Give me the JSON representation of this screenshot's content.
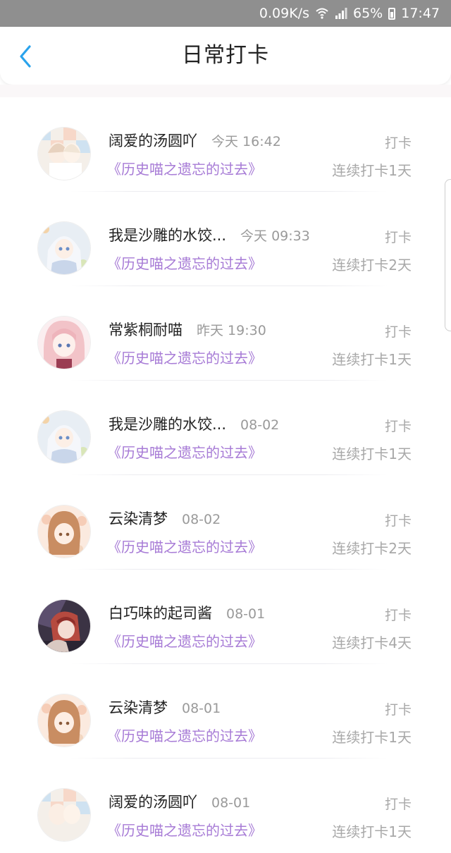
{
  "status_bar": {
    "speed": "0.09K/s",
    "battery": "65%",
    "time": "17:47",
    "icons": [
      "wifi-icon",
      "signal-icon",
      "battery-icon"
    ]
  },
  "header": {
    "title": "日常打卡",
    "back_icon": "chevron-left-icon"
  },
  "colors": {
    "accent": "#2aa3ec",
    "book_title": "#a77bd6",
    "muted": "#a8a8a8"
  },
  "entries": [
    {
      "username": "阔爱的汤圆吖",
      "time": "今天 16:42",
      "book": "《历史喵之遗忘的过去》",
      "action": "打卡",
      "streak": "连续打卡1天",
      "avatar": "avatar-girls-pair"
    },
    {
      "username": "我是沙雕的水饺...",
      "time": "今天 09:33",
      "book": "《历史喵之遗忘的过去》",
      "action": "打卡",
      "streak": "连续打卡2天",
      "avatar": "avatar-white-hair"
    },
    {
      "username": "常紫桐耐喵",
      "time": "昨天 19:30",
      "book": "《历史喵之遗忘的过去》",
      "action": "打卡",
      "streak": "连续打卡1天",
      "avatar": "avatar-pink-hair"
    },
    {
      "username": "我是沙雕的水饺...",
      "time": "08-02",
      "book": "《历史喵之遗忘的过去》",
      "action": "打卡",
      "streak": "连续打卡1天",
      "avatar": "avatar-white-hair"
    },
    {
      "username": "云染清梦",
      "time": "08-02",
      "book": "《历史喵之遗忘的过去》",
      "action": "打卡",
      "streak": "连续打卡2天",
      "avatar": "avatar-brown-hair"
    },
    {
      "username": "白巧味的起司酱",
      "time": "08-01",
      "book": "《历史喵之遗忘的过去》",
      "action": "打卡",
      "streak": "连续打卡4天",
      "avatar": "avatar-red-dark"
    },
    {
      "username": "云染清梦",
      "time": "08-01",
      "book": "《历史喵之遗忘的过去》",
      "action": "打卡",
      "streak": "连续打卡1天",
      "avatar": "avatar-brown-hair"
    },
    {
      "username": "阔爱的汤圆吖",
      "time": "08-01",
      "book": "《历史喵之遗忘的过去》",
      "action": "打卡",
      "streak": "连续打卡1天",
      "avatar": "avatar-girls-pair"
    }
  ]
}
